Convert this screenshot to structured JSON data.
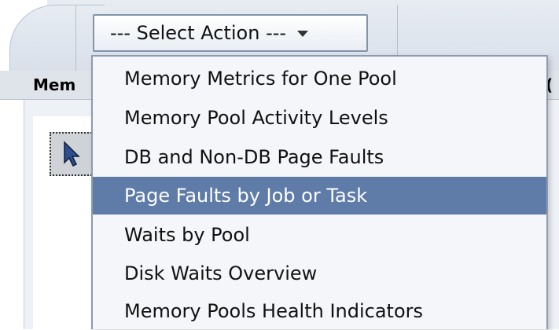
{
  "toolbar": {
    "select_action_label": "--- Select Action ---"
  },
  "table_header": {
    "first_column_label": "Mem",
    "right_column_label": "("
  },
  "menu": {
    "items": [
      {
        "label": "Memory Metrics for One Pool",
        "selected": false
      },
      {
        "label": "Memory Pool Activity Levels",
        "selected": false
      },
      {
        "label": "DB and Non-DB Page Faults",
        "selected": false
      },
      {
        "label": "Page Faults by Job or Task",
        "selected": true
      },
      {
        "label": "Waits by Pool",
        "selected": false
      },
      {
        "label": "Disk Waits Overview",
        "selected": false
      },
      {
        "label": "Memory Pools Health Indicators",
        "selected": false
      }
    ]
  },
  "icons": {
    "caret": "chevron-down-icon",
    "cursor": "pointer-cursor-icon"
  },
  "colors": {
    "selection_bg": "#5f7ba8",
    "menu_bg": "#f4f6f9",
    "toolbar_bg": "#dfe4ea"
  }
}
